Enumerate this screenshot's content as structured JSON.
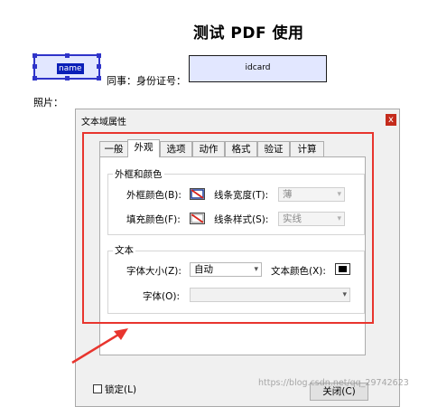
{
  "document": {
    "title": "测试 PDF 使用",
    "name_field": "name",
    "id_label": "同事：身份证号：",
    "idcard_field": "idcard",
    "photo_label": "照片："
  },
  "dialog": {
    "title": "文本域属性",
    "close_glyph": "x",
    "tabs": [
      {
        "label": "一般"
      },
      {
        "label": "外观"
      },
      {
        "label": "选项"
      },
      {
        "label": "动作"
      },
      {
        "label": "格式"
      },
      {
        "label": "验证"
      },
      {
        "label": "计算"
      }
    ],
    "active_tab": "外观",
    "border_group": {
      "title": "外框和颜色",
      "border_color_label": "外框颜色(B):",
      "line_width_label": "线条宽度(T):",
      "line_width_value": "薄",
      "fill_color_label": "填充颜色(F):",
      "line_style_label": "线条样式(S):",
      "line_style_value": "实线"
    },
    "text_group": {
      "title": "文本",
      "font_size_label": "字体大小(Z):",
      "font_size_value": "自动",
      "text_color_label": "文本颜色(X):",
      "font_label": "字体(O):",
      "font_value": ""
    },
    "lock_label": "锁定(L)",
    "close_button": "关闭(C)"
  },
  "watermark": "https://blog.csdn.net/qq_29742623",
  "colors": {
    "selection_blue": "#2f34c9",
    "field_fill": "#e2e7ff",
    "highlight_red": "#e8352e",
    "text_color_swatch": "#000000"
  }
}
